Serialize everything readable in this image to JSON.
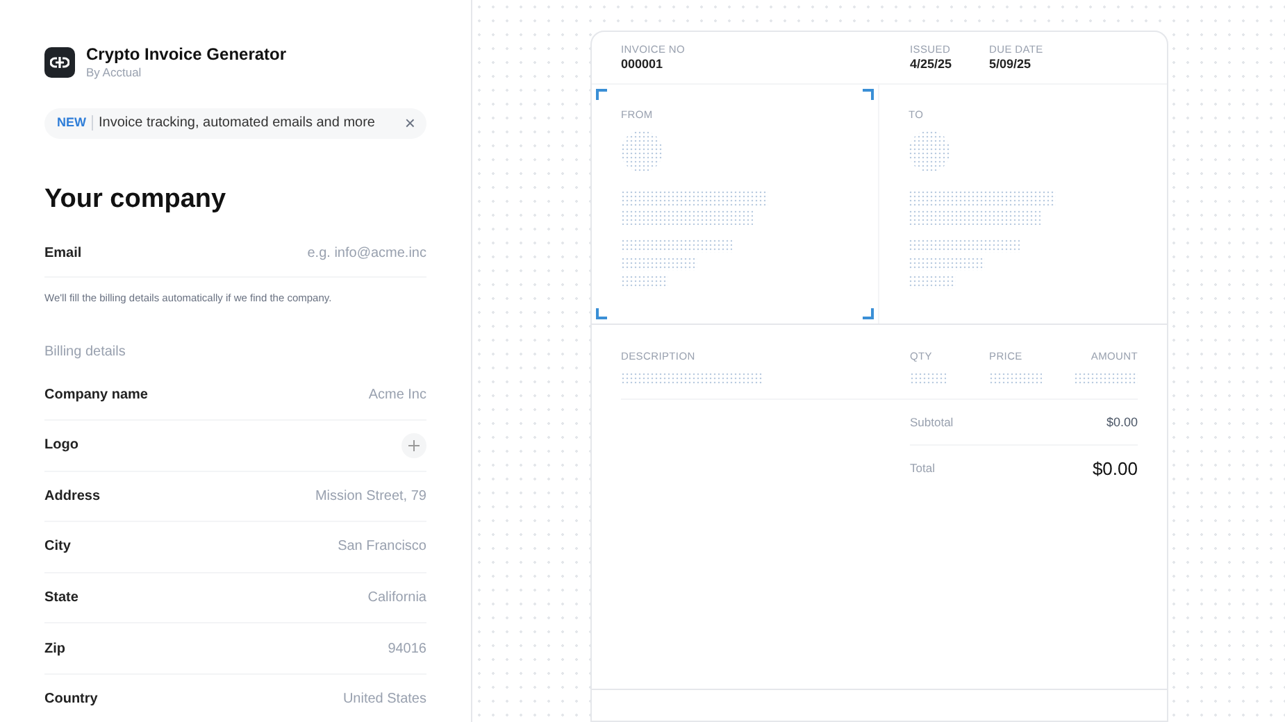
{
  "app": {
    "title": "Crypto Invoice Generator",
    "byline": "By Acctual"
  },
  "banner": {
    "badge": "NEW",
    "text": "Invoice tracking, automated emails and more",
    "close": "×"
  },
  "section": {
    "title": "Your company"
  },
  "email": {
    "label": "Email",
    "placeholder": "e.g. info@acme.inc",
    "help": "We'll fill the billing details automatically if we find the company."
  },
  "billing": {
    "title": "Billing details",
    "fields": [
      {
        "kind": "text",
        "label": "Company name",
        "placeholder": "Acme Inc"
      },
      {
        "kind": "upload",
        "label": "Logo"
      },
      {
        "kind": "text",
        "label": "Address",
        "placeholder": "Mission Street, 79"
      },
      {
        "kind": "text",
        "label": "City",
        "placeholder": "San Francisco"
      },
      {
        "kind": "text",
        "label": "State",
        "placeholder": "California"
      },
      {
        "kind": "text",
        "label": "Zip",
        "placeholder": "94016"
      },
      {
        "kind": "text",
        "label": "Country",
        "placeholder": "United States"
      }
    ]
  },
  "invoice": {
    "number_label": "INVOICE NO",
    "number": "000001",
    "issued_label": "ISSUED",
    "issued": "4/25/25",
    "due_label": "DUE DATE",
    "due": "5/09/25",
    "from": {
      "label": "FROM",
      "selected": true
    },
    "to": {
      "label": "TO",
      "selected": false
    },
    "columns": [
      "DESCRIPTION",
      "QTY",
      "PRICE",
      "AMOUNT"
    ],
    "subtotal_label": "Subtotal",
    "subtotal": "$0.00",
    "total_label": "Total",
    "total": "$0.00"
  }
}
